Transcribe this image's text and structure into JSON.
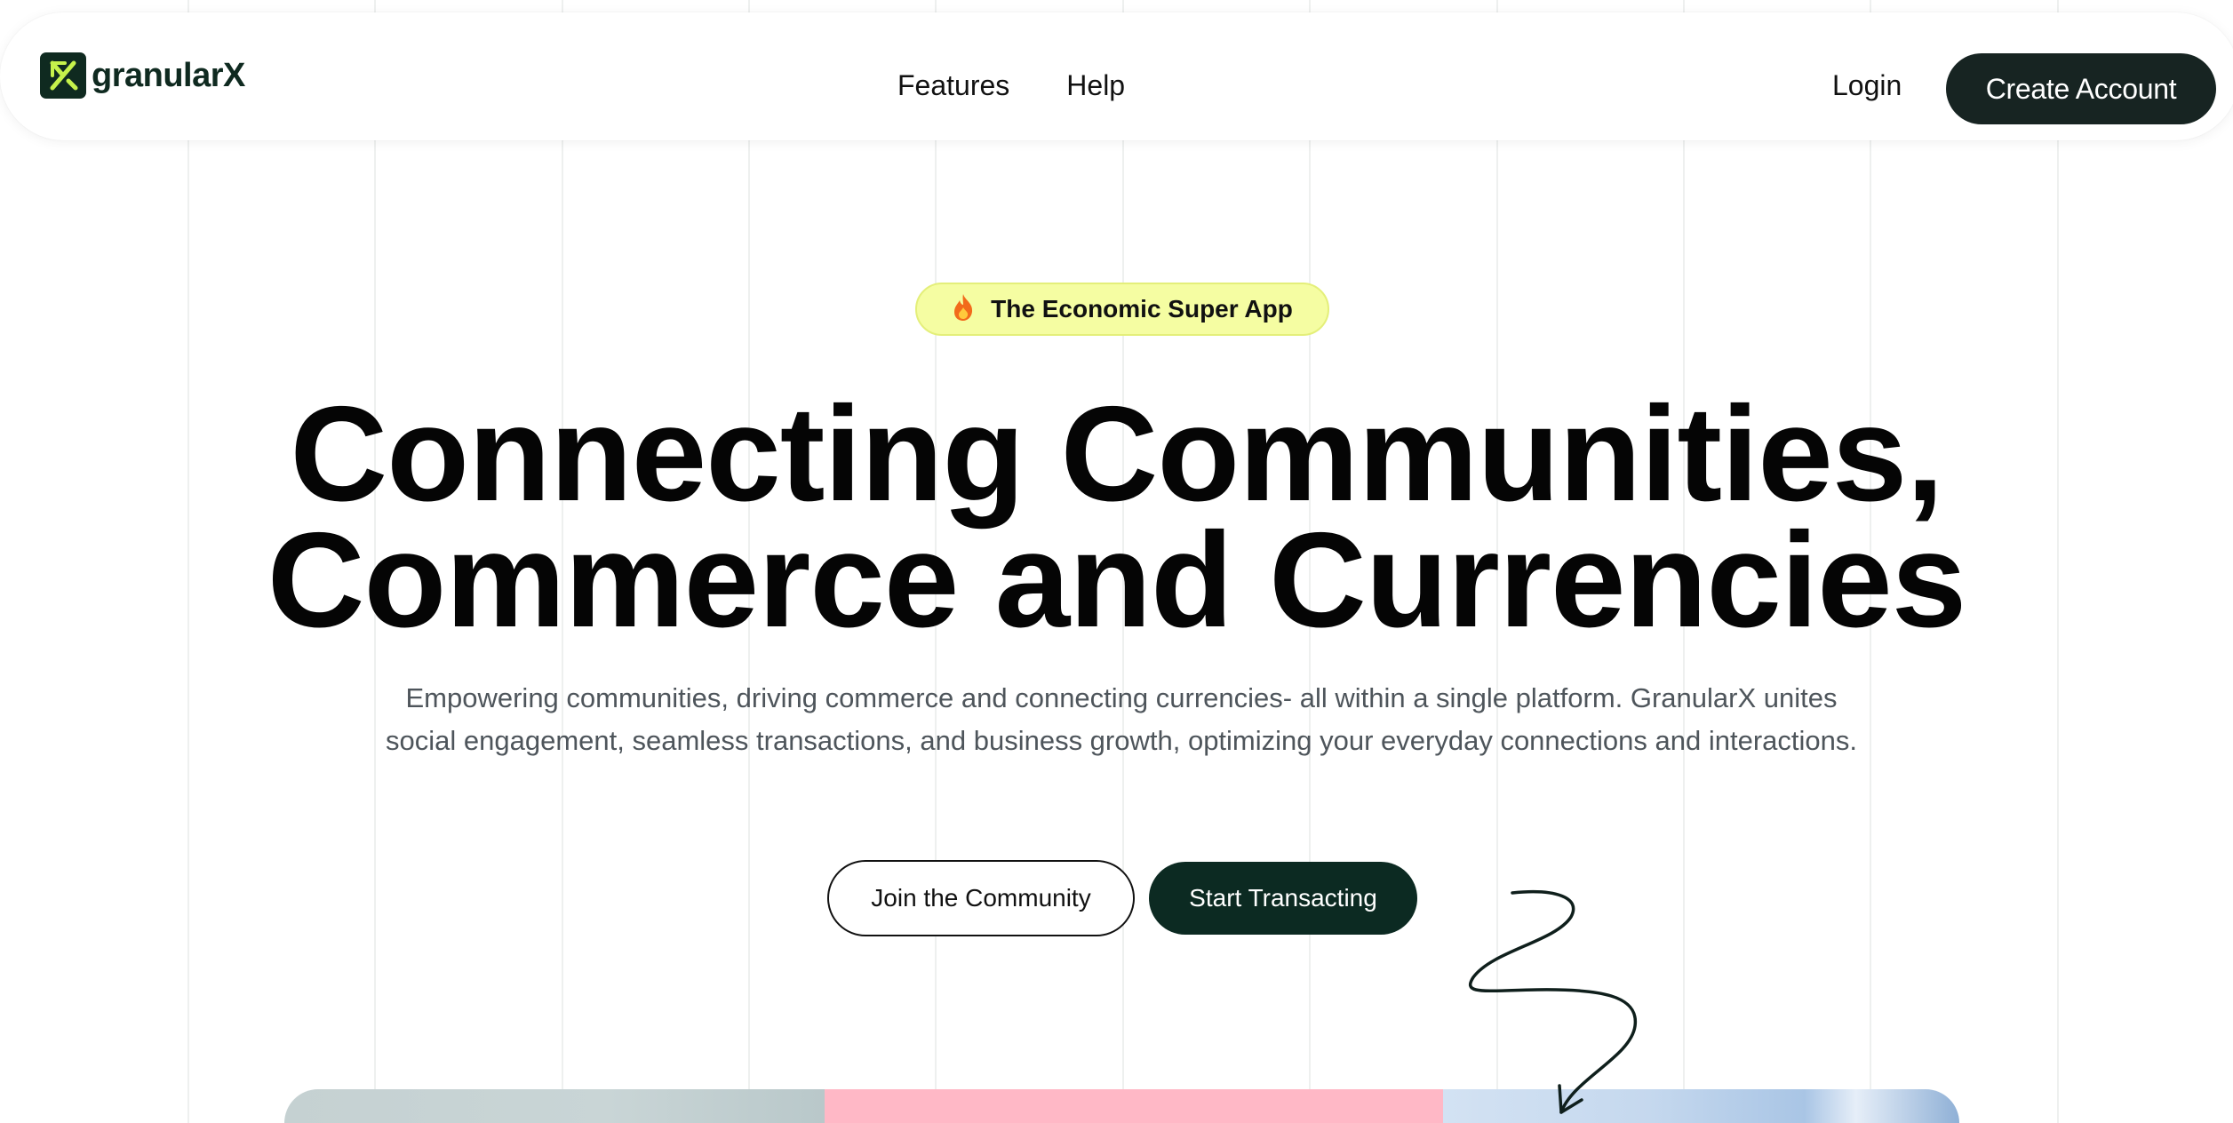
{
  "nav": {
    "brand": "granularX",
    "links": [
      "Features",
      "Help"
    ],
    "login": "Login",
    "create_account": "Create Account"
  },
  "hero": {
    "badge": "The Economic Super App",
    "headline_line1": "Connecting Communities,",
    "headline_line2": "Commerce and Currencies",
    "subtext": "Empowering communities, driving commerce and connecting currencies- all within a single platform. GranularX unites social engagement, seamless transactions, and business growth, optimizing your everyday connections and interactions.",
    "join_button": "Join the Community",
    "start_button": "Start Transacting"
  },
  "icons": {
    "logo": "granularx-logo-icon",
    "badge": "fire-icon",
    "arrow": "squiggle-arrow-icon"
  },
  "colors": {
    "brand_dark": "#0f2a20",
    "brand_lime": "#c6f24b",
    "badge_bg": "#f5fda2",
    "primary_button": "#0c2a22"
  }
}
